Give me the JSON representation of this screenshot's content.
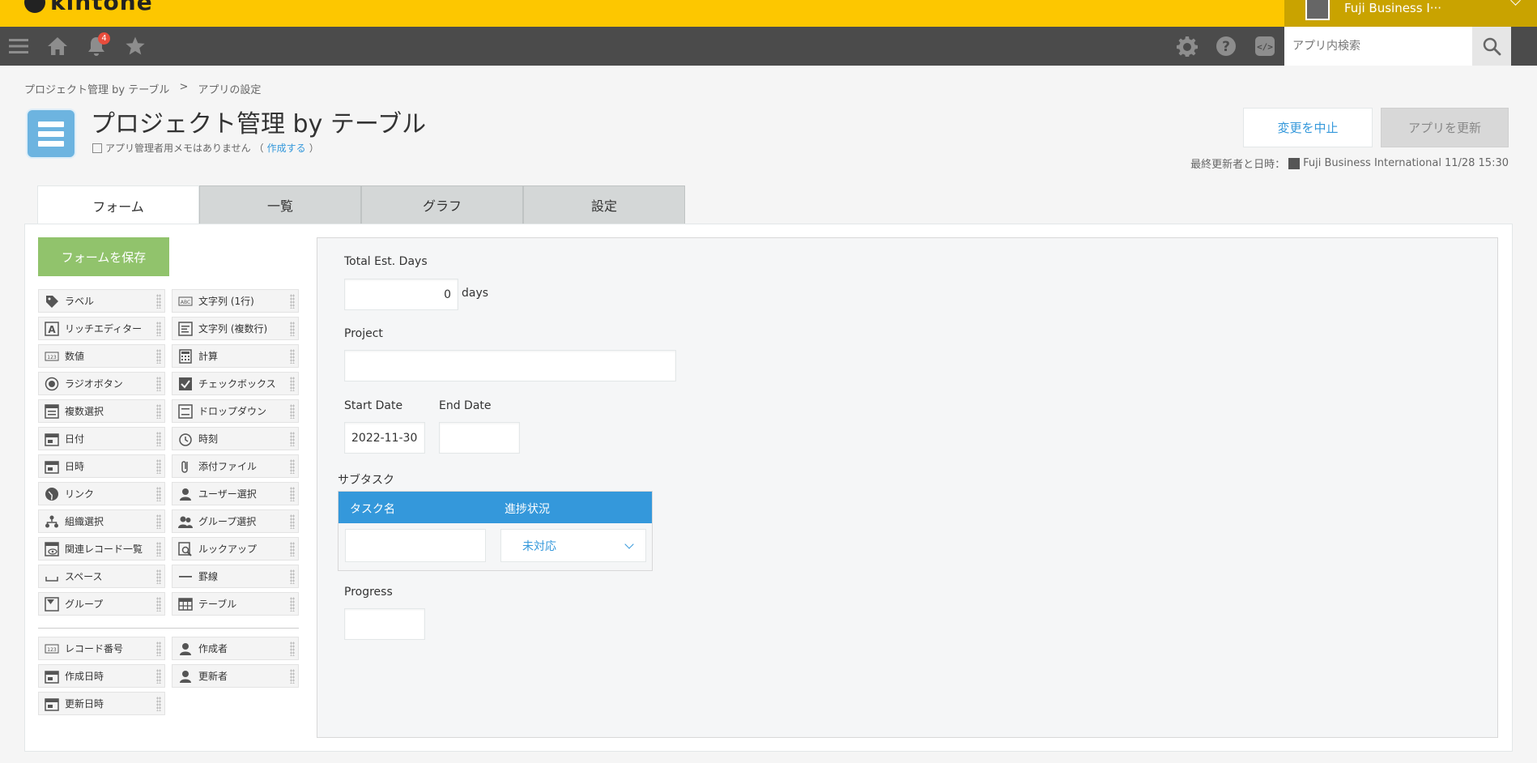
{
  "brand": {
    "name": "kintone"
  },
  "topbar": {
    "user_name": "Fuji Business I···"
  },
  "nav": {
    "notification_count": "4",
    "search_placeholder": "アプリ内検索"
  },
  "breadcrumb": {
    "items": [
      "プロジェクト管理 by テーブル",
      ">",
      "アプリの設定"
    ]
  },
  "app": {
    "title": "プロジェクト管理 by テーブル",
    "memo_text": "アプリ管理者用メモはありません",
    "memo_link": "作成する",
    "memo_open": "（",
    "memo_close": "）"
  },
  "actions": {
    "cancel_label": "変更を中止",
    "update_label": "アプリを更新"
  },
  "last_updated": {
    "label": "最終更新者と日時：",
    "user": "Fuji Business International",
    "datetime": "11/28 15:30"
  },
  "tabs": [
    "フォーム",
    "一覧",
    "グラフ",
    "設定"
  ],
  "palette": {
    "save_label": "フォームを保存",
    "items": [
      "ラベル",
      "文字列 (1行)",
      "リッチエディター",
      "文字列 (複数行)",
      "数値",
      "計算",
      "ラジオボタン",
      "チェックボックス",
      "複数選択",
      "ドロップダウン",
      "日付",
      "時刻",
      "日時",
      "添付ファイル",
      "リンク",
      "ユーザー選択",
      "組織選択",
      "グループ選択",
      "関連レコード一覧",
      "ルックアップ",
      "スペース",
      "罫線",
      "グループ",
      "テーブル"
    ],
    "system_items": [
      "レコード番号",
      "作成者",
      "作成日時",
      "更新者",
      "更新日時"
    ]
  },
  "form": {
    "total_days_label": "Total Est. Days",
    "total_days_value": "0",
    "total_days_unit": "days",
    "project_label": "Project",
    "start_date_label": "Start Date",
    "start_date_value": "2022-11-30",
    "end_date_label": "End Date",
    "subtable_label": "サブタスク",
    "subtable_col1": "タスク名",
    "subtable_col2": "進捗状況",
    "subtable_status_value": "未対応",
    "progress_label": "Progress"
  },
  "colors": {
    "brand_yellow": "#fdc700",
    "nav_dark": "#4b4b4b",
    "accent_blue": "#3498db",
    "save_green": "#91c36c"
  }
}
